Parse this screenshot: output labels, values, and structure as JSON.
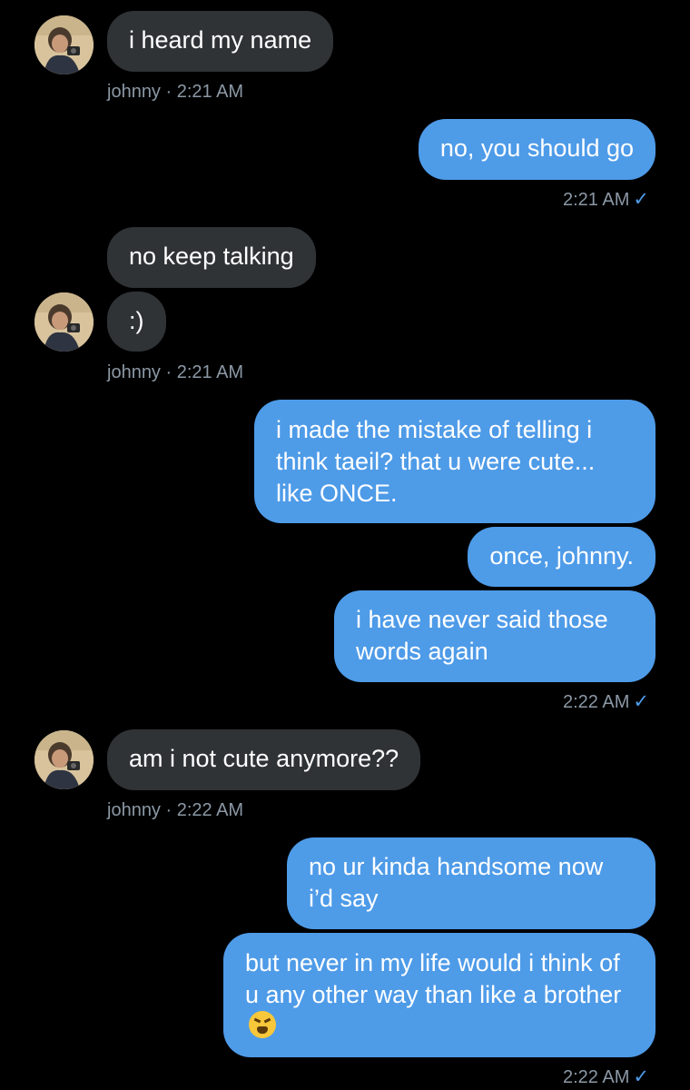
{
  "sender_name": "johnny",
  "colors": {
    "background": "#000000",
    "incoming_bubble": "#2f3336",
    "outgoing_bubble": "#4e9be8",
    "meta_text": "#8b98a5",
    "read_check": "#4e9be8"
  },
  "icons": {
    "avatar": "avatar-photo",
    "read_receipt": "checkmark-icon",
    "emoji": "tired-face-emoji"
  },
  "messages": [
    {
      "direction": "incoming",
      "text": "i heard my name"
    },
    {
      "direction": "outgoing",
      "text": "no, you should go"
    },
    {
      "direction": "incoming",
      "text": "no keep talking"
    },
    {
      "direction": "incoming",
      "text": ":)"
    },
    {
      "direction": "outgoing",
      "text": "i made the mistake of telling i think taeil? that u were cute... like ONCE."
    },
    {
      "direction": "outgoing",
      "text": "once, johnny."
    },
    {
      "direction": "outgoing",
      "text": "i have never said those words again"
    },
    {
      "direction": "incoming",
      "text": "am i not cute anymore??"
    },
    {
      "direction": "outgoing",
      "text": "no ur kinda handsome now i’d say"
    },
    {
      "direction": "outgoing",
      "text": "but never in my life would i think of u any other way than like a brother"
    }
  ],
  "meta": {
    "group1": "johnny · 2:21 AM",
    "group2": "2:21 AM",
    "group3": "johnny · 2:21 AM",
    "group4": "2:22 AM",
    "group5": "johnny · 2:22 AM",
    "group6": "2:22 AM"
  },
  "check_glyph": "✓"
}
